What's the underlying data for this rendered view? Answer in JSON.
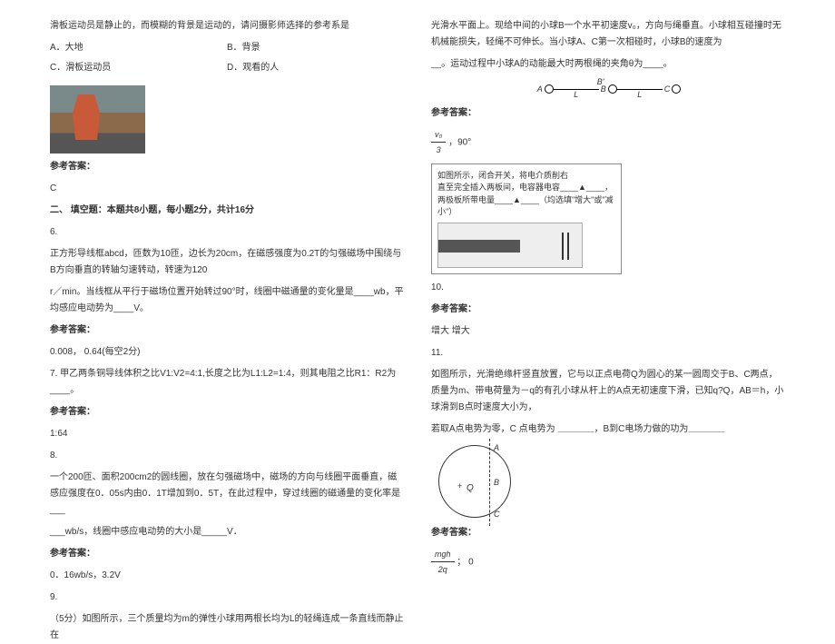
{
  "left": {
    "q5_stem": "滑板运动员是静止的，而模糊的背景是运动的，请问摄影师选择的参考系是",
    "optA": "A．大地",
    "optB": "B．背景",
    "optC": "C．滑板运动员",
    "optD": "D．观看的人",
    "ans_label": "参考答案：",
    "ans5": "C",
    "section2": "二、 填空题：本题共8小题，每小题2分，共计16分",
    "q6n": "6.",
    "q6_l1": "正方形导线框abcd，匝数为10匝，边长为20cm，在磁感强度为0.2T的匀强磁场中围绕与B方向垂直的转轴匀速转动，转速为120",
    "q6_l2": "r／min。当线框从平行于磁场位置开始转过90°时，线圈中磁通量的变化量是____wb，平均感应电动势为____V。",
    "ans6": "0.008，  0.64(每空2分)",
    "q7": "7. 甲乙两条铜导线体积之比V1:V2=4:1,长度之比为L1:L2=1:4，则其电阻之比R1：R2为____。",
    "ans7": "1:64",
    "q8n": "8.",
    "q8_l1": "一个200匝、面积200cm2的圆线圈，放在匀强磁场中，磁场的方向与线圈平面垂直，磁感应强度在0．05s内由0．1T增加到0．5T，在此过程中，穿过线圈的磁通量的变化率是___",
    "q8_l2": "___wb/s，线圈中感应电动势的大小是_____V．",
    "ans8": "0．16wb/s，3.2V",
    "q9n": "9.",
    "q9": "（5分）如图所示，三个质量均为m的弹性小球用两根长均为L的轻绳连成一条直线而静止在"
  },
  "right": {
    "q9_cont1": "光滑水平面上。现给中间的小球B一个水平初速度v₀，方向与绳垂直。小球相互碰撞时无机械能损失，轻绳不可伸长。当小球A、C第一次相碰时，小球B的速度为",
    "q9_cont2": "__。运动过程中小球A的动能最大时两根绳的夹角θ为____。",
    "A": "A",
    "B": "B",
    "C": "C",
    "L": "L",
    "Bp": "B'",
    "ans_label": "参考答案：",
    "ans9b": "，90°",
    "cap_l1": "如图所示，闭合开关，将电介质削右",
    "cap_l2": "直至完全插入两板间，电容器电容____▲____，",
    "cap_l3": "两极板所带电量____▲____（均选填\"增大\"或\"减小\"）",
    "q10n": "10.",
    "ans10": "增大      增大",
    "q11n": "11.",
    "q11_l1": "如图所示，光滑绝缘杆竖直放置，它与以正点电荷Q为圆心的某一圆周交于B、C两点，质量为m、带电荷量为－q的有孔小球从杆上的A点无初速度下滑，已知q?Q，AB＝h，小球滑到B点时速度大小为，",
    "q11_l2": "若取A点电势为零，C 点电势为 ＿＿＿＿，B到C电场力做的功为＿＿＿＿",
    "Qc": "Q",
    "mgh": "mgh",
    "den2q": "2q",
    "ans11b": "；     0"
  },
  "frac": {
    "v0": "v₀",
    "three": "3"
  }
}
